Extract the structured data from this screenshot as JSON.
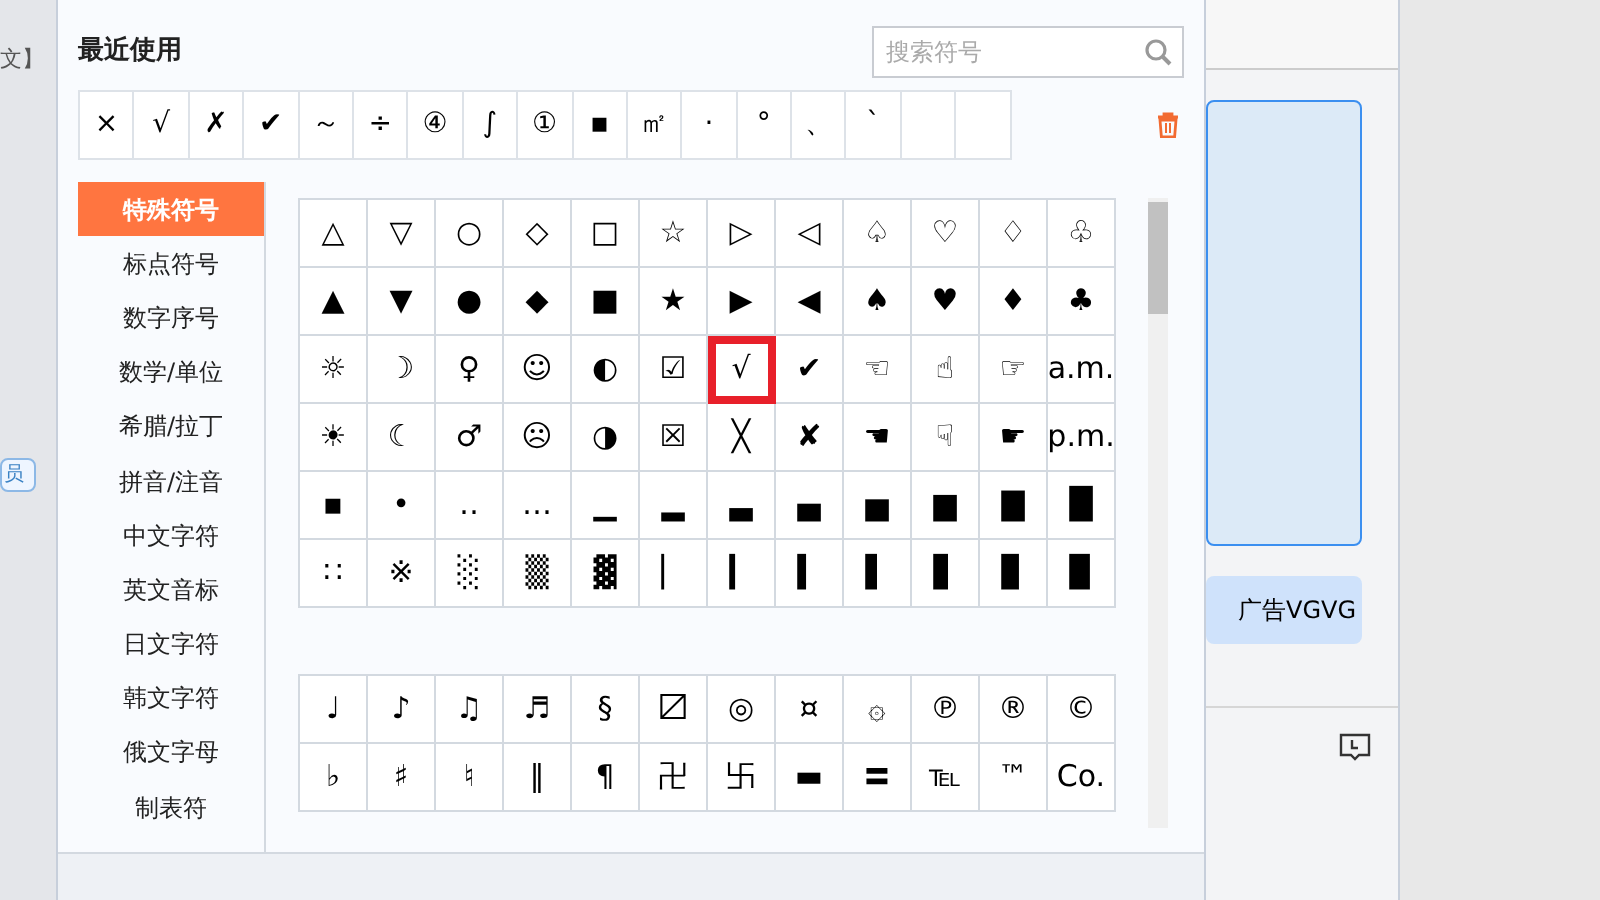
{
  "background": {
    "left_texts": [
      "文】",
      "员"
    ],
    "ad_button": "广告VGVG"
  },
  "recent": {
    "title": "最近使用",
    "symbols": [
      "×",
      "√",
      "✗",
      "✔",
      "～",
      "÷",
      "④",
      "∫",
      "①",
      "▪",
      "㎡",
      "·",
      "°",
      "、",
      "`"
    ]
  },
  "search": {
    "placeholder": "搜索符号"
  },
  "categories": [
    {
      "label": "特殊符号",
      "selected": true
    },
    {
      "label": "标点符号",
      "selected": false
    },
    {
      "label": "数字序号",
      "selected": false
    },
    {
      "label": "数学/单位",
      "selected": false
    },
    {
      "label": "希腊/拉丁",
      "selected": false
    },
    {
      "label": "拼音/注音",
      "selected": false
    },
    {
      "label": "中文字符",
      "selected": false
    },
    {
      "label": "英文音标",
      "selected": false
    },
    {
      "label": "日文字符",
      "selected": false
    },
    {
      "label": "韩文字符",
      "selected": false
    },
    {
      "label": "俄文字母",
      "selected": false
    },
    {
      "label": "制表符",
      "selected": false
    }
  ],
  "grids": [
    {
      "cells": [
        {
          "s": "△",
          "selected": false
        },
        {
          "s": "▽",
          "selected": false
        },
        {
          "s": "○",
          "selected": false
        },
        {
          "s": "◇",
          "selected": false
        },
        {
          "s": "□",
          "selected": false
        },
        {
          "s": "☆",
          "selected": false
        },
        {
          "s": "▷",
          "selected": false
        },
        {
          "s": "◁",
          "selected": false
        },
        {
          "s": "♤",
          "selected": false
        },
        {
          "s": "♡",
          "selected": false
        },
        {
          "s": "♢",
          "selected": false
        },
        {
          "s": "♧",
          "selected": false
        },
        {
          "s": "▲",
          "selected": false
        },
        {
          "s": "▼",
          "selected": false
        },
        {
          "s": "●",
          "selected": false
        },
        {
          "s": "◆",
          "selected": false
        },
        {
          "s": "■",
          "selected": false
        },
        {
          "s": "★",
          "selected": false
        },
        {
          "s": "▶",
          "selected": false
        },
        {
          "s": "◀",
          "selected": false
        },
        {
          "s": "♠",
          "selected": false
        },
        {
          "s": "♥",
          "selected": false
        },
        {
          "s": "♦",
          "selected": false
        },
        {
          "s": "♣",
          "selected": false
        },
        {
          "s": "☼",
          "selected": false
        },
        {
          "s": "☽",
          "selected": false
        },
        {
          "s": "♀",
          "selected": false
        },
        {
          "s": "☺",
          "selected": false
        },
        {
          "s": "◐",
          "selected": false
        },
        {
          "s": "☑",
          "selected": false
        },
        {
          "s": "√",
          "selected": true
        },
        {
          "s": "✔",
          "selected": false
        },
        {
          "s": "☜",
          "selected": false
        },
        {
          "s": "☝",
          "selected": false
        },
        {
          "s": "☞",
          "selected": false
        },
        {
          "s": "a.m.",
          "selected": false
        },
        {
          "s": "☀",
          "selected": false
        },
        {
          "s": "☾",
          "selected": false
        },
        {
          "s": "♂",
          "selected": false
        },
        {
          "s": "☹",
          "selected": false
        },
        {
          "s": "◑",
          "selected": false
        },
        {
          "s": "☒",
          "selected": false
        },
        {
          "s": "╳",
          "selected": false
        },
        {
          "s": "✘",
          "selected": false
        },
        {
          "s": "☚",
          "selected": false
        },
        {
          "s": "☟",
          "selected": false
        },
        {
          "s": "☛",
          "selected": false
        },
        {
          "s": "p.m.",
          "selected": false
        },
        {
          "s": "▪",
          "selected": false
        },
        {
          "s": "•",
          "selected": false
        },
        {
          "s": "‥",
          "selected": false
        },
        {
          "s": "…",
          "selected": false
        },
        {
          "s": "▁",
          "selected": false
        },
        {
          "s": "▂",
          "selected": false
        },
        {
          "s": "▃",
          "selected": false
        },
        {
          "s": "▄",
          "selected": false
        },
        {
          "s": "▅",
          "selected": false
        },
        {
          "s": "▆",
          "selected": false
        },
        {
          "s": "▇",
          "selected": false
        },
        {
          "s": "█",
          "selected": false
        },
        {
          "s": "∷",
          "selected": false
        },
        {
          "s": "※",
          "selected": false
        },
        {
          "s": "░",
          "selected": false
        },
        {
          "s": "▒",
          "selected": false
        },
        {
          "s": "▓",
          "selected": false
        },
        {
          "s": "▏",
          "selected": false
        },
        {
          "s": "▎",
          "selected": false
        },
        {
          "s": "▍",
          "selected": false
        },
        {
          "s": "▌",
          "selected": false
        },
        {
          "s": "▋",
          "selected": false
        },
        {
          "s": "▊",
          "selected": false
        },
        {
          "s": "▉",
          "selected": false
        }
      ]
    },
    {
      "cells": [
        {
          "s": "♩",
          "selected": false
        },
        {
          "s": "♪",
          "selected": false
        },
        {
          "s": "♫",
          "selected": false
        },
        {
          "s": "♬",
          "selected": false
        },
        {
          "s": "§",
          "selected": false
        },
        {
          "s": "〼",
          "selected": false
        },
        {
          "s": "◎",
          "selected": false
        },
        {
          "s": "¤",
          "selected": false
        },
        {
          "s": "۞",
          "selected": false
        },
        {
          "s": "℗",
          "selected": false
        },
        {
          "s": "®",
          "selected": false
        },
        {
          "s": "©",
          "selected": false
        },
        {
          "s": "♭",
          "selected": false
        },
        {
          "s": "♯",
          "selected": false
        },
        {
          "s": "♮",
          "selected": false
        },
        {
          "s": "‖",
          "selected": false
        },
        {
          "s": "¶",
          "selected": false
        },
        {
          "s": "卍",
          "selected": false
        },
        {
          "s": "卐",
          "selected": false
        },
        {
          "s": "▬",
          "selected": false
        },
        {
          "s": "〓",
          "selected": false
        },
        {
          "s": "℡",
          "selected": false
        },
        {
          "s": "™",
          "selected": false
        },
        {
          "s": "Co.",
          "selected": false
        }
      ]
    }
  ]
}
